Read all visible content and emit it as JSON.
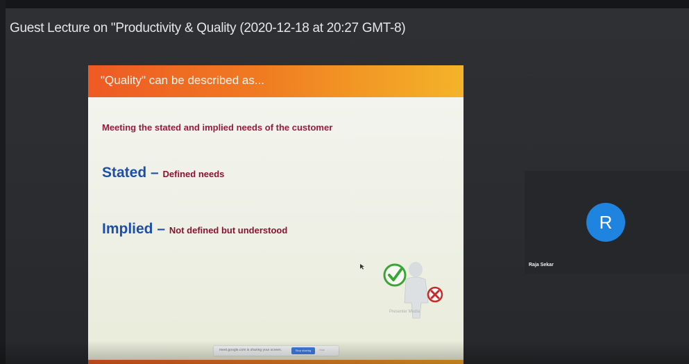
{
  "meeting": {
    "title": "Guest Lecture on \"Productivity & Quality (2020-12-18 at 20:27 GMT-8)"
  },
  "slide": {
    "header": "\"Quality\" can be described as...",
    "main_line": "Meeting the stated and implied needs of the customer",
    "terms": [
      {
        "term": "Stated",
        "dash": " – ",
        "description": "Defined needs"
      },
      {
        "term": "Implied",
        "dash": " – ",
        "description": "Not defined but understood"
      }
    ],
    "figure_caption": "Presenter Media",
    "colors": {
      "header_start": "#ee5a24",
      "header_end": "#f4b32a",
      "term": "#1e4fa8",
      "text": "#9a1a3a"
    }
  },
  "share_bar": {
    "message": "meet.google.com is sharing your screen.",
    "stop_label": "Stop sharing",
    "hide_label": "Hide"
  },
  "participant": {
    "initial": "R",
    "name": "Raja Sekar",
    "avatar_color": "#1f84e0"
  }
}
